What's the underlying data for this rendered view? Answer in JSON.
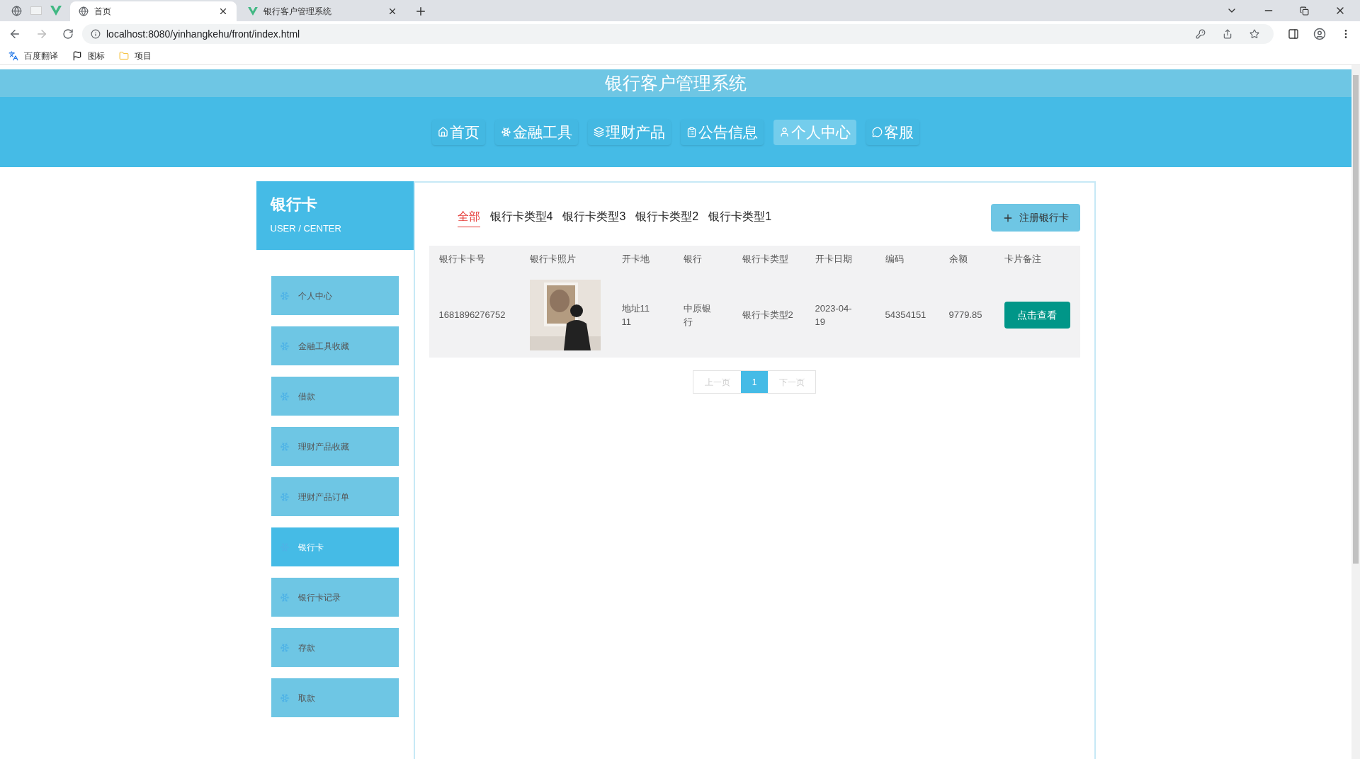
{
  "browser": {
    "tabs": [
      {
        "title": "首页",
        "selected": true
      },
      {
        "title": "银行客户管理系统",
        "selected": false
      }
    ],
    "address": "localhost:8080/yinhangkehu/front/index.html",
    "bookmarks": [
      "百度翻译",
      "图标",
      "项目"
    ]
  },
  "site": {
    "title": "银行客户管理系统"
  },
  "nav": [
    {
      "label": "首页",
      "kind": "home",
      "selected": false
    },
    {
      "label": "金融工具",
      "kind": "snow",
      "selected": false
    },
    {
      "label": "理财产品",
      "kind": "layers",
      "selected": false
    },
    {
      "label": "公告信息",
      "kind": "notice",
      "selected": false
    },
    {
      "label": "个人中心",
      "kind": "user",
      "selected": true
    },
    {
      "label": "客服",
      "kind": "chat",
      "selected": false
    }
  ],
  "sidebar": {
    "title": "银行卡",
    "subtitle": "USER / CENTER",
    "items": [
      {
        "label": "个人中心",
        "selected": false
      },
      {
        "label": "金融工具收藏",
        "selected": false
      },
      {
        "label": "借款",
        "selected": false
      },
      {
        "label": "理财产品收藏",
        "selected": false
      },
      {
        "label": "理财产品订单",
        "selected": false
      },
      {
        "label": "银行卡",
        "selected": true
      },
      {
        "label": "银行卡记录",
        "selected": false
      },
      {
        "label": "存款",
        "selected": false
      },
      {
        "label": "取款",
        "selected": false
      }
    ]
  },
  "categories": [
    {
      "label": "全部",
      "selected": true
    },
    {
      "label": "银行卡类型4",
      "selected": false
    },
    {
      "label": "银行卡类型3",
      "selected": false
    },
    {
      "label": "银行卡类型2",
      "selected": false
    },
    {
      "label": "银行卡类型1",
      "selected": false
    }
  ],
  "register_button": "注册银行卡",
  "table": {
    "columns": [
      "银行卡卡号",
      "银行卡照片",
      "开卡地",
      "银行",
      "银行卡类型",
      "开卡日期",
      "编码",
      "余额",
      "卡片备注"
    ],
    "rows": [
      {
        "card_number": "1681896276752",
        "location": "地址1111",
        "bank": "中原银行",
        "card_type": "银行卡类型2",
        "open_date": "2023-04-19",
        "code": "54354151",
        "balance": "9779.85",
        "action": "点击查看"
      }
    ]
  },
  "pagination": {
    "prev": "上一页",
    "pages": [
      {
        "label": "1",
        "selected": true
      }
    ],
    "next": "下一页"
  }
}
